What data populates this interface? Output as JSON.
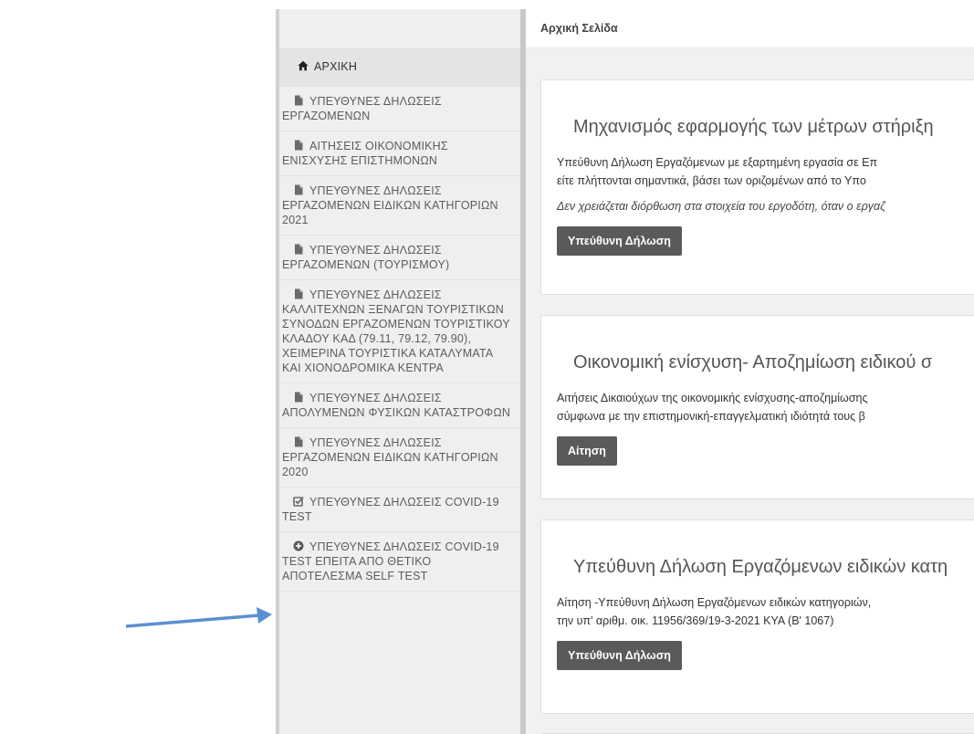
{
  "topbar": {
    "breadcrumb": "Αρχική Σελίδα"
  },
  "sidebar": {
    "items": [
      {
        "label": "ΑΡΧΙΚΗ",
        "icon": "home-icon"
      },
      {
        "label": "ΥΠΕΥΘΥΝΕΣ ΔΗΛΩΣΕΙΣ ΕΡΓΑΖΟΜΕΝΩΝ",
        "icon": "document-icon"
      },
      {
        "label": "ΑΙΤΗΣΕΙΣ ΟΙΚΟΝΟΜΙΚΗΣ ΕΝΙΣΧΥΣΗΣ ΕΠΙΣΤΗΜΟΝΩΝ",
        "icon": "document-icon"
      },
      {
        "label": "ΥΠΕΥΘΥΝΕΣ ΔΗΛΩΣΕΙΣ ΕΡΓΑΖΟΜΕΝΩΝ ΕΙΔΙΚΩΝ ΚΑΤΗΓΟΡΙΩΝ 2021",
        "icon": "document-icon"
      },
      {
        "label": "ΥΠΕΥΘΥΝΕΣ ΔΗΛΩΣΕΙΣ ΕΡΓΑΖΟΜΕΝΩΝ (ΤΟΥΡΙΣΜΟΥ)",
        "icon": "document-icon"
      },
      {
        "label": "ΥΠΕΥΘΥΝΕΣ ΔΗΛΩΣΕΙΣ ΚΑΛΛΙΤΕΧΝΩΝ ΞΕΝΑΓΩΝ ΤΟΥΡΙΣΤΙΚΩΝ ΣΥΝΟΔΩΝ ΕΡΓΑΖΟΜΕΝΩΝ ΤΟΥΡΙΣΤΙΚΟΥ ΚΛΑΔΟΥ ΚΑΔ (79.11, 79.12, 79.90), ΧΕΙΜΕΡΙΝΑ ΤΟΥΡΙΣΤΙΚΑ ΚΑΤΑΛΥΜΑΤΑ ΚΑΙ ΧΙΟΝΟΔΡΟΜΙΚΑ ΚΕΝΤΡΑ",
        "icon": "document-icon"
      },
      {
        "label": "ΥΠΕΥΘΥΝΕΣ ΔΗΛΩΣΕΙΣ ΑΠΟΛΥΜΕΝΩΝ ΦΥΣΙΚΩΝ ΚΑΤΑΣΤΡΟΦΩΝ",
        "icon": "document-icon"
      },
      {
        "label": "ΥΠΕΥΘΥΝΕΣ ΔΗΛΩΣΕΙΣ ΕΡΓΑΖΟΜΕΝΩΝ ΕΙΔΙΚΩΝ ΚΑΤΗΓΟΡΙΩΝ 2020",
        "icon": "document-icon"
      },
      {
        "label": "ΥΠΕΥΘΥΝΕΣ ΔΗΛΩΣΕΙΣ COVID-19 TEST",
        "icon": "checkbox-icon"
      },
      {
        "label": "ΥΠΕΥΘΥΝΕΣ ΔΗΛΩΣΕΙΣ COVID-19 TEST ΕΠΕΙΤΑ ΑΠΟ ΘΕΤΙΚΟ ΑΠΟΤΕΛΕΣΜΑ SELF TEST",
        "icon": "plus-circle-icon"
      }
    ]
  },
  "cards": [
    {
      "title": "Μηχανισμός εφαρμογής των μέτρων στήριξη",
      "desc1": "Υπεύθυνη Δήλωση Εργαζόμενων με εξαρτημένη εργασία σε Επ",
      "desc2": "είτε πλήττονται σημαντικά, βάσει των οριζομένων από το Υπο",
      "note": "Δεν χρειάζεται διόρθωση στα στοιχεία του εργοδότη, όταν ο εργαζ",
      "button": "Υπεύθυνη Δήλωση"
    },
    {
      "title": "Οικονομική ενίσχυση- Αποζημίωση ειδικού σ",
      "desc1": "Αιτήσεις Δικαιούχων της οικονομικής ενίσχυσης-αποζημίωσης",
      "desc2": "σύμφωνα με την επιστημονική-επαγγελματική ιδιότητά τους β",
      "button": "Αίτηση"
    },
    {
      "title": "Υπεύθυνη Δήλωση Εργαζόμενων ειδικών κατη",
      "desc1": "Αίτηση -Υπεύθυνη Δήλωση Εργαζόμενων ειδικών κατηγοριών,",
      "desc2": "την υπ' αριθμ. οικ. 11956/369/19-3-2021 ΚΥΑ (Β' 1067)",
      "button": "Υπεύθυνη Δήλωση"
    }
  ],
  "colors": {
    "arrow": "#5b8fd1",
    "button_bg": "#5a5a5a",
    "sidebar_bg": "#efefef",
    "main_bg": "#f1f1f1"
  }
}
